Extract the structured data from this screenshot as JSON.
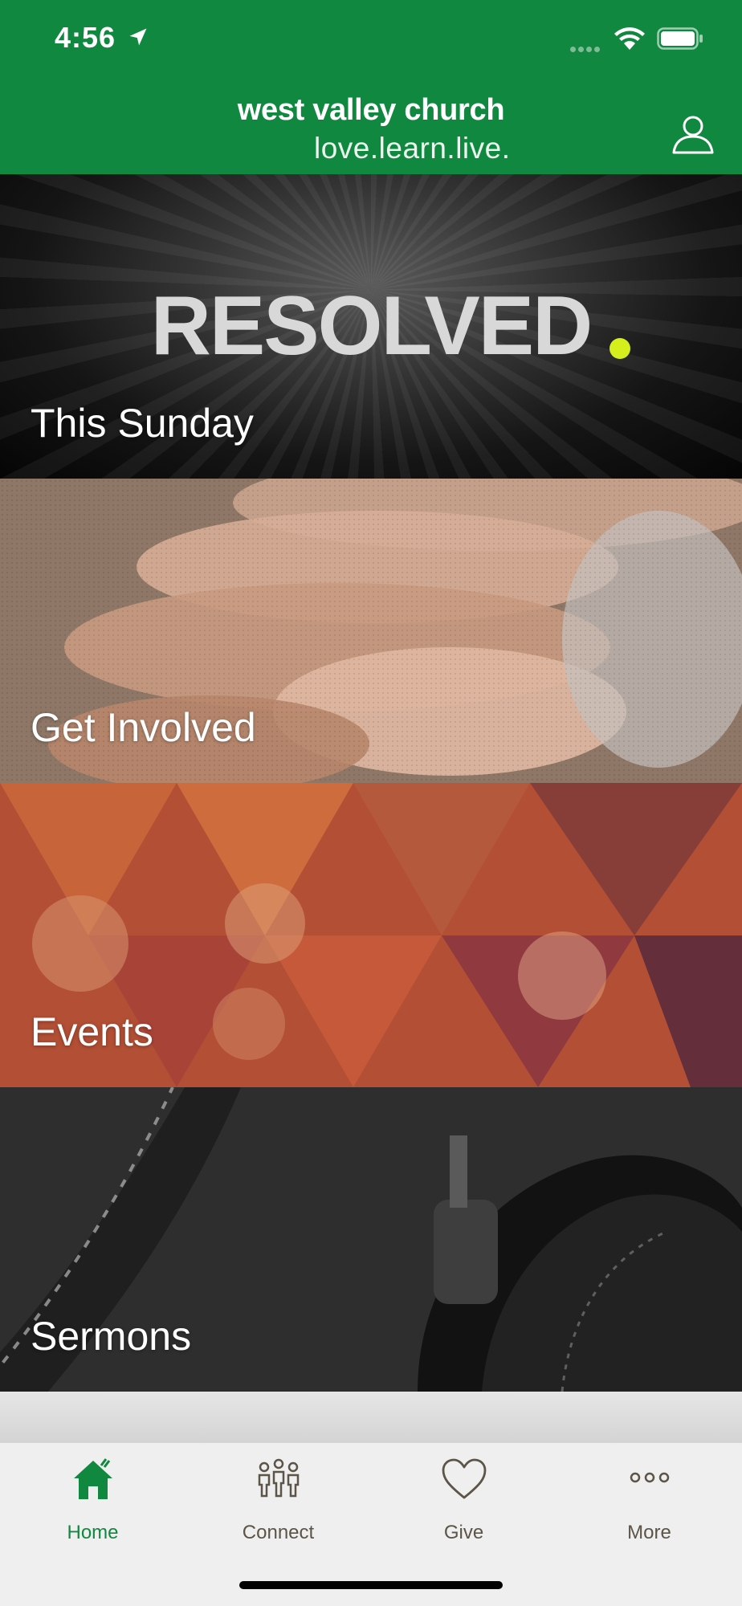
{
  "status_bar": {
    "time": "4:56"
  },
  "header": {
    "title": "west valley church",
    "tagline": "love.learn.live."
  },
  "tiles": [
    {
      "label": "This Sunday",
      "graphic_text": "RESOLVED"
    },
    {
      "label": "Get Involved"
    },
    {
      "label": "Events"
    },
    {
      "label": "Sermons"
    }
  ],
  "tab_bar": {
    "items": [
      {
        "label": "Home",
        "icon": "home-icon",
        "active": true
      },
      {
        "label": "Connect",
        "icon": "people-icon",
        "active": false
      },
      {
        "label": "Give",
        "icon": "heart-icon",
        "active": false
      },
      {
        "label": "More",
        "icon": "more-icon",
        "active": false
      }
    ]
  },
  "colors": {
    "brand_green": "#118840",
    "accent_dot": "#d4ef1c",
    "tab_inactive": "#5b5447"
  }
}
